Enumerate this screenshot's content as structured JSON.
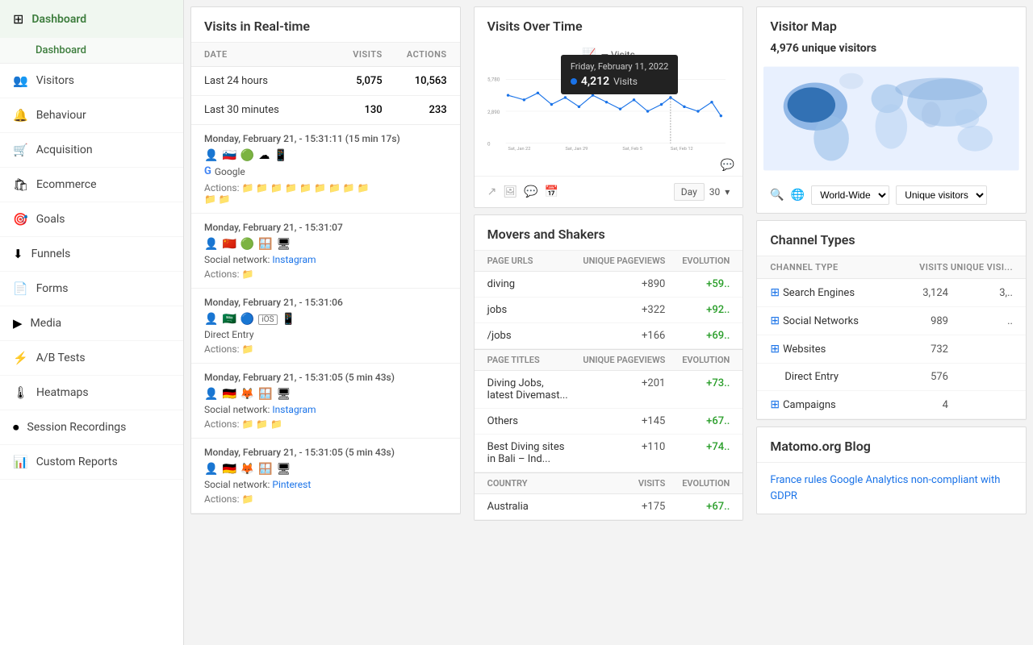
{
  "sidebar": {
    "items": [
      {
        "id": "dashboard",
        "label": "Dashboard",
        "icon": "⊞",
        "active": true,
        "sub": "Dashboard"
      },
      {
        "id": "visitors",
        "label": "Visitors",
        "icon": "👥"
      },
      {
        "id": "behaviour",
        "label": "Behaviour",
        "icon": "🔔"
      },
      {
        "id": "acquisition",
        "label": "Acquisition",
        "icon": "🛒"
      },
      {
        "id": "ecommerce",
        "label": "Ecommerce",
        "icon": "🛍"
      },
      {
        "id": "goals",
        "label": "Goals",
        "icon": "🎯"
      },
      {
        "id": "funnels",
        "label": "Funnels",
        "icon": "⬇"
      },
      {
        "id": "forms",
        "label": "Forms",
        "icon": "📄"
      },
      {
        "id": "media",
        "label": "Media",
        "icon": "▶"
      },
      {
        "id": "abtests",
        "label": "A/B Tests",
        "icon": "⚡"
      },
      {
        "id": "heatmaps",
        "label": "Heatmaps",
        "icon": "🌡"
      },
      {
        "id": "session-recordings",
        "label": "Session Recordings",
        "icon": "⏺"
      },
      {
        "id": "custom-reports",
        "label": "Custom Reports",
        "icon": "📊"
      }
    ]
  },
  "realtime": {
    "title": "Visits in Real-time",
    "headers": {
      "date": "DATE",
      "visits": "VISITS",
      "actions": "ACTIONS"
    },
    "summary_rows": [
      {
        "label": "Last 24 hours",
        "visits": "5,075",
        "actions": "10,563"
      },
      {
        "label": "Last 30 minutes",
        "visits": "130",
        "actions": "233"
      }
    ],
    "visits": [
      {
        "time": "Monday, February 21, - 15:31:11 (15 min 17s)",
        "icons": [
          "👤",
          "🇸🇮",
          "🟢",
          "☁",
          "📱"
        ],
        "source_label": "",
        "source_name": "Google",
        "source_url": "#",
        "source_icon": "G",
        "actions_label": "Actions:",
        "action_icons": [
          "📁",
          "📁",
          "📁",
          "📁",
          "📁",
          "📁",
          "📁",
          "📁",
          "📁",
          "📁",
          "📁"
        ]
      },
      {
        "time": "Monday, February 21, - 15:31:07",
        "icons": [
          "👤",
          "🇨🇳",
          "🟢",
          "🪟",
          "🖥"
        ],
        "source_label": "Social network: ",
        "source_name": "Instagram",
        "source_url": "#",
        "actions_label": "Actions:",
        "action_icons": [
          "📁"
        ]
      },
      {
        "time": "Monday, February 21, - 15:31:06",
        "icons": [
          "👤",
          "🇸🇦",
          "🔵",
          "iOS",
          "📱"
        ],
        "source_label": "Direct Entry",
        "source_name": "",
        "source_url": "",
        "actions_label": "Actions:",
        "action_icons": [
          "📁"
        ]
      },
      {
        "time": "Monday, February 21, - 15:31:05 (5 min 43s)",
        "icons": [
          "👤",
          "🇩🇪",
          "🦊",
          "🪟",
          "🖥"
        ],
        "source_label": "Social network: ",
        "source_name": "Instagram",
        "source_url": "#",
        "actions_label": "Actions:",
        "action_icons": [
          "📁",
          "📁",
          "📁"
        ]
      },
      {
        "time": "Monday, February 21, - 15:31:05 (5 min 43s)",
        "icons": [
          "👤",
          "🇩🇪",
          "🦊",
          "🪟",
          "🖥"
        ],
        "source_label": "Social network: ",
        "source_name": "Pinterest",
        "source_url": "#",
        "actions_label": "Actions:",
        "action_icons": [
          "📁"
        ]
      }
    ]
  },
  "overtime": {
    "title": "Visits Over Time",
    "legend": "Visits",
    "y_max": "5,780",
    "y_mid": "2,890",
    "y_min": "0",
    "x_labels": [
      "Sat, Jan 22",
      "Sat, Jan 29",
      "Sat, Feb 5",
      "Sat, Feb 12"
    ],
    "tooltip": {
      "date": "Friday, February 11, 2022",
      "visits": "4,212",
      "label": "Visits"
    },
    "toolbar": {
      "buttons": [
        "share-icon",
        "image-icon",
        "comment-icon",
        "calendar-icon"
      ],
      "period": "Day",
      "range": "30"
    }
  },
  "movers": {
    "title": "Movers and Shakers",
    "sections": [
      {
        "header": {
          "col1": "PAGE URLS",
          "col2": "UNIQUE PAGEVIEWS",
          "col3": "EVOLUTION"
        },
        "rows": [
          {
            "url": "diving",
            "pageviews": "+890",
            "evolution": "+59.."
          },
          {
            "url": "jobs",
            "pageviews": "+322",
            "evolution": "+92.."
          },
          {
            "url": "/jobs",
            "pageviews": "+166",
            "evolution": "+69.."
          }
        ]
      },
      {
        "header": {
          "col1": "PAGE TITLES",
          "col2": "UNIQUE PAGEVIEWS",
          "col3": "EVOLUTION"
        },
        "rows": [
          {
            "url": "Diving Jobs, latest Divemast...",
            "pageviews": "+201",
            "evolution": "+73.."
          },
          {
            "url": "Others",
            "pageviews": "+145",
            "evolution": "+67.."
          },
          {
            "url": "Best Diving sites in Bali – Ind...",
            "pageviews": "+110",
            "evolution": "+74.."
          }
        ]
      },
      {
        "header": {
          "col1": "COUNTRY",
          "col2": "VISITS",
          "col3": "EVOLUTION"
        },
        "rows": [
          {
            "url": "Australia",
            "pageviews": "+175",
            "evolution": "+67.."
          }
        ]
      }
    ]
  },
  "visitormap": {
    "title": "Visitor Map",
    "unique_visitors": "4,976 unique visitors",
    "controls": {
      "region": "World-Wide",
      "metric": "Unique visitors"
    }
  },
  "channel_types": {
    "title": "Channel Types",
    "headers": {
      "type": "CHANNEL TYPE",
      "visits": "VISITS",
      "unique": "UNIQUE VISI..."
    },
    "rows": [
      {
        "type": "Search Engines",
        "visits": "3,124",
        "unique": "3,.."
      },
      {
        "type": "Social Networks",
        "visits": "989",
        "unique": ".."
      },
      {
        "type": "Websites",
        "visits": "732",
        "unique": ""
      },
      {
        "type": "Direct Entry",
        "visits": "576",
        "unique": ""
      },
      {
        "type": "Campaigns",
        "visits": "4",
        "unique": ""
      }
    ]
  },
  "blog": {
    "title": "Matomo.org Blog",
    "link_text": "France rules Google Analytics non-compliant with GDPR"
  }
}
